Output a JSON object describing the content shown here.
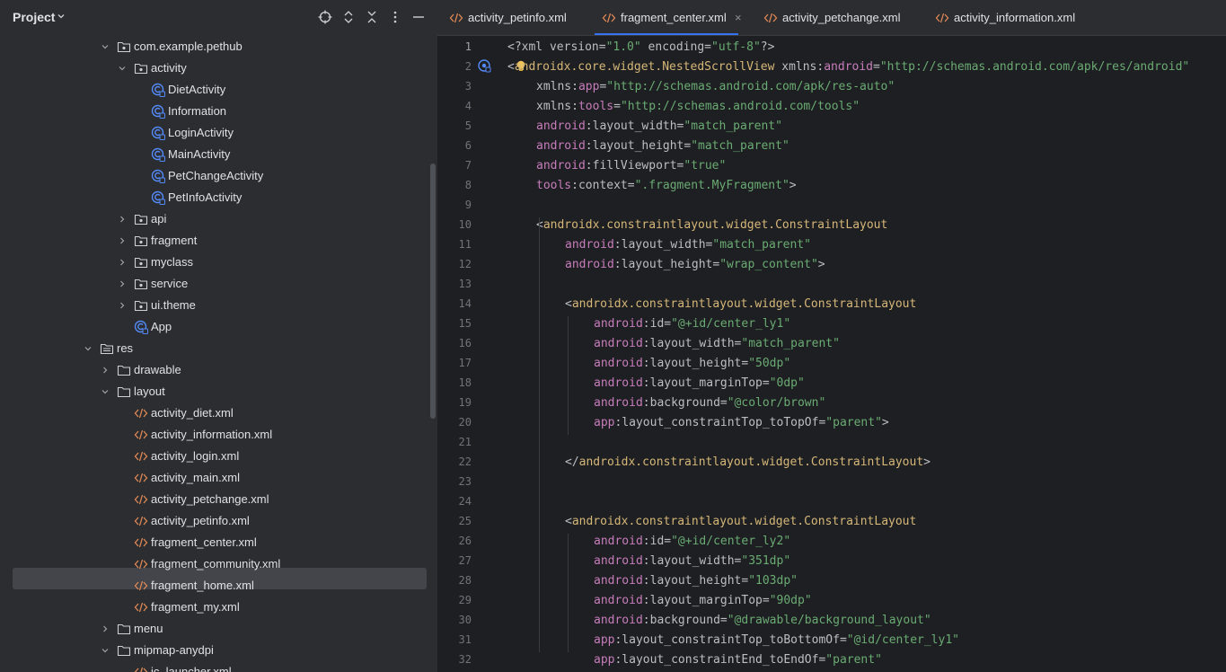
{
  "project_panel": {
    "title": "Project",
    "tree": [
      {
        "label": "com.example.pethub",
        "type": "package",
        "indent": 0,
        "expanded": true
      },
      {
        "label": "activity",
        "type": "package",
        "indent": 1,
        "expanded": true
      },
      {
        "label": "DietActivity",
        "type": "class",
        "indent": 2
      },
      {
        "label": "Information",
        "type": "class",
        "indent": 2
      },
      {
        "label": "LoginActivity",
        "type": "class",
        "indent": 2
      },
      {
        "label": "MainActivity",
        "type": "class",
        "indent": 2
      },
      {
        "label": "PetChangeActivity",
        "type": "class",
        "indent": 2
      },
      {
        "label": "PetInfoActivity",
        "type": "class",
        "indent": 2
      },
      {
        "label": "api",
        "type": "package",
        "indent": 1,
        "expanded": false
      },
      {
        "label": "fragment",
        "type": "package",
        "indent": 1,
        "expanded": false
      },
      {
        "label": "myclass",
        "type": "package",
        "indent": 1,
        "expanded": false
      },
      {
        "label": "service",
        "type": "package",
        "indent": 1,
        "expanded": false
      },
      {
        "label": "ui.theme",
        "type": "package",
        "indent": 1,
        "expanded": false
      },
      {
        "label": "App",
        "type": "class",
        "indent": 1
      },
      {
        "label": "res",
        "type": "res-folder",
        "indent": -1,
        "expanded": true
      },
      {
        "label": "drawable",
        "type": "folder",
        "indent": 0,
        "expanded": false
      },
      {
        "label": "layout",
        "type": "folder",
        "indent": 0,
        "expanded": true
      },
      {
        "label": "activity_diet.xml",
        "type": "xml",
        "indent": 1
      },
      {
        "label": "activity_information.xml",
        "type": "xml",
        "indent": 1
      },
      {
        "label": "activity_login.xml",
        "type": "xml",
        "indent": 1
      },
      {
        "label": "activity_main.xml",
        "type": "xml",
        "indent": 1
      },
      {
        "label": "activity_petchange.xml",
        "type": "xml",
        "indent": 1
      },
      {
        "label": "activity_petinfo.xml",
        "type": "xml",
        "indent": 1
      },
      {
        "label": "fragment_center.xml",
        "type": "xml",
        "indent": 1,
        "selected": true
      },
      {
        "label": "fragment_community.xml",
        "type": "xml",
        "indent": 1
      },
      {
        "label": "fragment_home.xml",
        "type": "xml",
        "indent": 1
      },
      {
        "label": "fragment_my.xml",
        "type": "xml",
        "indent": 1
      },
      {
        "label": "menu",
        "type": "folder",
        "indent": 0,
        "expanded": false
      },
      {
        "label": "mipmap-anydpi",
        "type": "folder",
        "indent": 0,
        "expanded": true
      },
      {
        "label": "ic_launcher.xml",
        "type": "xml",
        "indent": 1
      }
    ]
  },
  "tabs": [
    {
      "label": "activity_petinfo.xml",
      "active": false
    },
    {
      "label": "fragment_center.xml",
      "active": true,
      "close": "×"
    },
    {
      "label": "activity_petchange.xml",
      "active": false
    },
    {
      "label": "activity_information.xml",
      "active": false
    }
  ],
  "editor": {
    "current_line": 1,
    "lines": [
      {
        "n": "1",
        "indent": 0,
        "parts": [
          [
            "pun",
            "<?"
          ],
          [
            "attr",
            "xml version="
          ],
          [
            "val",
            "\"1.0\""
          ],
          [
            "attr",
            " encoding="
          ],
          [
            "val",
            "\"utf-8\""
          ],
          [
            "pun",
            "?>"
          ]
        ]
      },
      {
        "n": "2",
        "indent": 0,
        "parts": [
          [
            "pun",
            "<"
          ],
          [
            "tag",
            "androidx.core.widget.NestedScrollView "
          ],
          [
            "attr",
            "xmlns:"
          ],
          [
            "ns",
            "android"
          ],
          [
            "attr",
            "="
          ],
          [
            "val",
            "\"http://schemas.android.com/apk/res/android\""
          ]
        ]
      },
      {
        "n": "3",
        "indent": 1,
        "parts": [
          [
            "attr",
            "xmlns:"
          ],
          [
            "ns",
            "app"
          ],
          [
            "attr",
            "="
          ],
          [
            "val",
            "\"http://schemas.android.com/apk/res-auto\""
          ]
        ]
      },
      {
        "n": "4",
        "indent": 1,
        "parts": [
          [
            "attr",
            "xmlns:"
          ],
          [
            "ns",
            "tools"
          ],
          [
            "attr",
            "="
          ],
          [
            "val",
            "\"http://schemas.android.com/tools\""
          ]
        ]
      },
      {
        "n": "5",
        "indent": 1,
        "parts": [
          [
            "ns",
            "android"
          ],
          [
            "attr",
            ":layout_width="
          ],
          [
            "val",
            "\"match_parent\""
          ]
        ]
      },
      {
        "n": "6",
        "indent": 1,
        "parts": [
          [
            "ns",
            "android"
          ],
          [
            "attr",
            ":layout_height="
          ],
          [
            "val",
            "\"match_parent\""
          ]
        ]
      },
      {
        "n": "7",
        "indent": 1,
        "parts": [
          [
            "ns",
            "android"
          ],
          [
            "attr",
            ":fillViewport="
          ],
          [
            "val",
            "\"true\""
          ]
        ]
      },
      {
        "n": "8",
        "indent": 1,
        "parts": [
          [
            "ns",
            "tools"
          ],
          [
            "attr",
            ":context="
          ],
          [
            "val",
            "\".fragment.MyFragment\""
          ],
          [
            "pun",
            ">"
          ]
        ]
      },
      {
        "n": "9",
        "indent": 0,
        "parts": []
      },
      {
        "n": "10",
        "indent": 1,
        "parts": [
          [
            "pun",
            "<"
          ],
          [
            "tag",
            "androidx.constraintlayout.widget.ConstraintLayout"
          ]
        ]
      },
      {
        "n": "11",
        "indent": 2,
        "parts": [
          [
            "ns",
            "android"
          ],
          [
            "attr",
            ":layout_width="
          ],
          [
            "val",
            "\"match_parent\""
          ]
        ]
      },
      {
        "n": "12",
        "indent": 2,
        "parts": [
          [
            "ns",
            "android"
          ],
          [
            "attr",
            ":layout_height="
          ],
          [
            "val",
            "\"wrap_content\""
          ],
          [
            "pun",
            ">"
          ]
        ]
      },
      {
        "n": "13",
        "indent": 0,
        "parts": []
      },
      {
        "n": "14",
        "indent": 2,
        "parts": [
          [
            "pun",
            "<"
          ],
          [
            "tag",
            "androidx.constraintlayout.widget.ConstraintLayout"
          ]
        ]
      },
      {
        "n": "15",
        "indent": 3,
        "parts": [
          [
            "ns",
            "android"
          ],
          [
            "attr",
            ":id="
          ],
          [
            "val",
            "\"@+id/center_ly1\""
          ]
        ]
      },
      {
        "n": "16",
        "indent": 3,
        "parts": [
          [
            "ns",
            "android"
          ],
          [
            "attr",
            ":layout_width="
          ],
          [
            "val",
            "\"match_parent\""
          ]
        ]
      },
      {
        "n": "17",
        "indent": 3,
        "parts": [
          [
            "ns",
            "android"
          ],
          [
            "attr",
            ":layout_height="
          ],
          [
            "val",
            "\"50dp\""
          ]
        ]
      },
      {
        "n": "18",
        "indent": 3,
        "parts": [
          [
            "ns",
            "android"
          ],
          [
            "attr",
            ":layout_marginTop="
          ],
          [
            "val",
            "\"0dp\""
          ]
        ]
      },
      {
        "n": "19",
        "indent": 3,
        "parts": [
          [
            "ns",
            "android"
          ],
          [
            "attr",
            ":background="
          ],
          [
            "val",
            "\"@color/brown\""
          ]
        ]
      },
      {
        "n": "20",
        "indent": 3,
        "parts": [
          [
            "ns",
            "app"
          ],
          [
            "attr",
            ":layout_constraintTop_toTopOf="
          ],
          [
            "val",
            "\"parent\""
          ],
          [
            "pun",
            ">"
          ]
        ]
      },
      {
        "n": "21",
        "indent": 0,
        "parts": []
      },
      {
        "n": "22",
        "indent": 2,
        "parts": [
          [
            "pun",
            "</"
          ],
          [
            "tag",
            "androidx.constraintlayout.widget.ConstraintLayout"
          ],
          [
            "pun",
            ">"
          ]
        ]
      },
      {
        "n": "23",
        "indent": 0,
        "parts": []
      },
      {
        "n": "24",
        "indent": 0,
        "parts": []
      },
      {
        "n": "25",
        "indent": 2,
        "parts": [
          [
            "pun",
            "<"
          ],
          [
            "tag",
            "androidx.constraintlayout.widget.ConstraintLayout"
          ]
        ]
      },
      {
        "n": "26",
        "indent": 3,
        "parts": [
          [
            "ns",
            "android"
          ],
          [
            "attr",
            ":id="
          ],
          [
            "val",
            "\"@+id/center_ly2\""
          ]
        ]
      },
      {
        "n": "27",
        "indent": 3,
        "parts": [
          [
            "ns",
            "android"
          ],
          [
            "attr",
            ":layout_width="
          ],
          [
            "val",
            "\"351dp\""
          ]
        ]
      },
      {
        "n": "28",
        "indent": 3,
        "parts": [
          [
            "ns",
            "android"
          ],
          [
            "attr",
            ":layout_height="
          ],
          [
            "val",
            "\"103dp\""
          ]
        ]
      },
      {
        "n": "29",
        "indent": 3,
        "parts": [
          [
            "ns",
            "android"
          ],
          [
            "attr",
            ":layout_marginTop="
          ],
          [
            "val",
            "\"90dp\""
          ]
        ]
      },
      {
        "n": "30",
        "indent": 3,
        "parts": [
          [
            "ns",
            "android"
          ],
          [
            "attr",
            ":background="
          ],
          [
            "val",
            "\"@drawable/background_layout\""
          ]
        ]
      },
      {
        "n": "31",
        "indent": 3,
        "parts": [
          [
            "ns",
            "app"
          ],
          [
            "attr",
            ":layout_constraintTop_toBottomOf="
          ],
          [
            "val",
            "\"@id/center_ly1\""
          ]
        ]
      },
      {
        "n": "32",
        "indent": 3,
        "parts": [
          [
            "ns",
            "app"
          ],
          [
            "attr",
            ":layout_constraintEnd_toEndOf="
          ],
          [
            "val",
            "\"parent\""
          ]
        ]
      }
    ]
  },
  "colors": {
    "accent": "#3574f0",
    "tag": "#d5b778",
    "namespace": "#c77dbb",
    "string": "#6aab73",
    "folder": "#ced0d6",
    "class_icon": "#548af7",
    "xml_icon": "#e08855"
  }
}
